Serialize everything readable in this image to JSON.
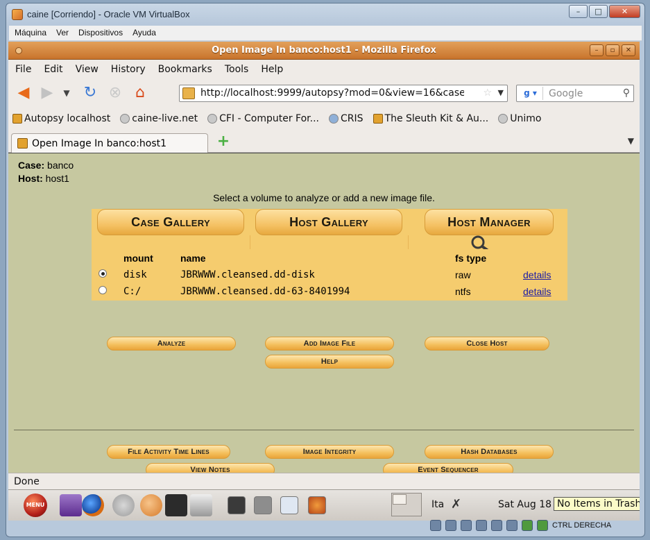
{
  "vbox": {
    "title": "caine [Corriendo] - Oracle VM VirtualBox",
    "menu": [
      "Máquina",
      "Ver",
      "Dispositivos",
      "Ayuda"
    ],
    "status_key": "CTRL DERECHA"
  },
  "firefox": {
    "title": "Open Image In banco:host1 - Mozilla Firefox",
    "menu": [
      "File",
      "Edit",
      "View",
      "History",
      "Bookmarks",
      "Tools",
      "Help"
    ],
    "url": "http://localhost:9999/autopsy?mod=0&view=16&case",
    "search_placeholder": "Google",
    "bookmarks": [
      "Autopsy localhost",
      "caine-live.net",
      "CFI - Computer For...",
      "CRIS",
      "The Sleuth Kit & Au...",
      "Unimo"
    ],
    "tab_title": "Open Image In banco:host1",
    "status": "Done"
  },
  "page": {
    "case_label": "Case:",
    "case_value": "banco",
    "host_label": "Host:",
    "host_value": "host1",
    "prompt": "Select a volume to analyze or add a new image file.",
    "gallery_tabs": [
      "Case Gallery",
      "Host Gallery",
      "Host Manager"
    ],
    "table_headers": {
      "mount": "mount",
      "name": "name",
      "fstype": "fs type"
    },
    "volumes": [
      {
        "mount": "disk",
        "name": "JBRWWW.cleansed.dd-disk",
        "fstype": "raw",
        "link": "details",
        "selected": true
      },
      {
        "mount": "C:/",
        "name": "JBRWWW.cleansed.dd-63-8401994",
        "fstype": "ntfs",
        "link": "details",
        "selected": false
      }
    ],
    "buttons": {
      "analyze": "Analyze",
      "add_image": "Add Image File",
      "close_host": "Close Host",
      "help": "Help",
      "file_activity": "File Activity Time Lines",
      "image_integrity": "Image Integrity",
      "hash_databases": "Hash Databases",
      "view_notes": "View Notes",
      "event_sequencer": "Event Sequencer"
    }
  },
  "panel": {
    "menu_label": "MENU",
    "keyboard": "Ita",
    "clock": "Sat Aug 18",
    "tooltip": "No Items in Trash"
  }
}
